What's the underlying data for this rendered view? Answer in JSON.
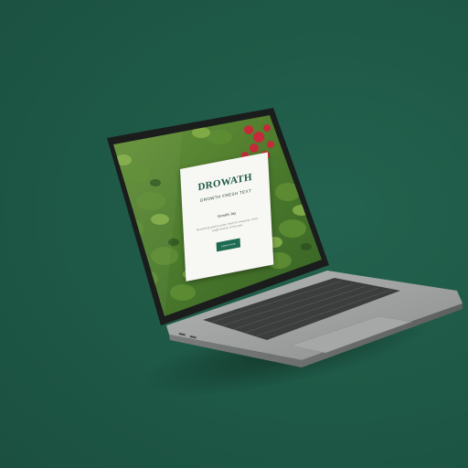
{
  "site": {
    "logo_text": "DROWATH",
    "tagline": "GROWTH FRESH TEXT",
    "heading": "Growth Jay",
    "body": "Nourishing greens grown fresh for everyone, every single season of the year.",
    "button_label": "Learn more"
  },
  "colors": {
    "background": "#1f5a48",
    "brand_green": "#1e6a52",
    "card": "#f7f7f4",
    "laptop_body": "#9a9c9b"
  },
  "device": {
    "type": "laptop-icon"
  }
}
